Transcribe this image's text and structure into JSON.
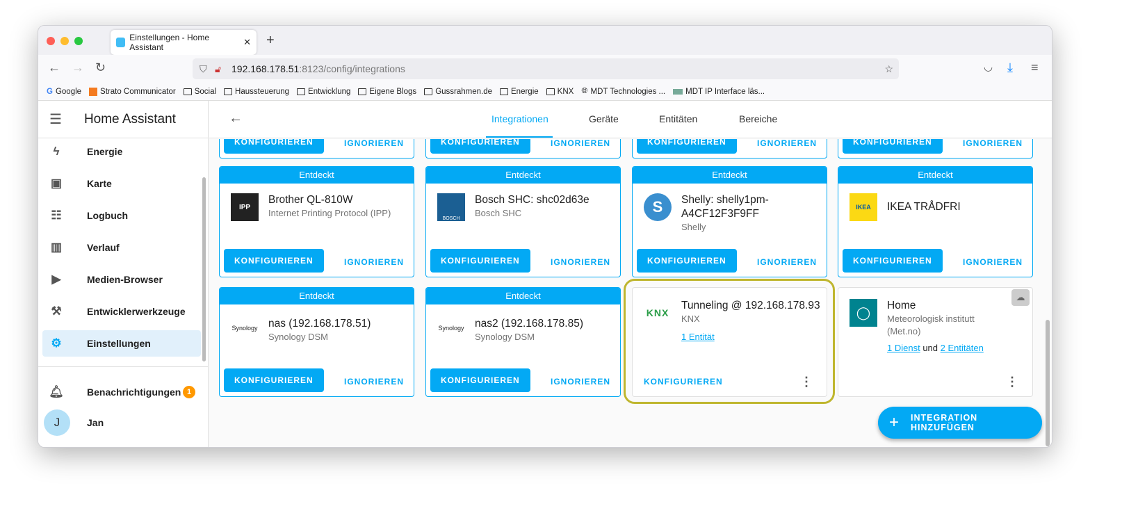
{
  "browser": {
    "tab_title": "Einstellungen - Home Assistant",
    "url_host": "192.168.178.51",
    "url_rest": ":8123/config/integrations",
    "bookmarks": [
      "Google",
      "Strato Communicator",
      "Social",
      "Haussteuerung",
      "Entwicklung",
      "Eigene Blogs",
      "Gussrahmen.de",
      "Energie",
      "KNX",
      "MDT Technologies ...",
      "MDT IP Interface läs..."
    ]
  },
  "sidebar": {
    "title": "Home Assistant",
    "items": [
      {
        "label": "Energie",
        "icon": "lightning-icon"
      },
      {
        "label": "Karte",
        "icon": "map-icon"
      },
      {
        "label": "Logbuch",
        "icon": "list-icon"
      },
      {
        "label": "Verlauf",
        "icon": "chart-icon"
      },
      {
        "label": "Medien-Browser",
        "icon": "play-icon"
      },
      {
        "label": "Entwicklerwerkzeuge",
        "icon": "hammer-icon"
      },
      {
        "label": "Einstellungen",
        "icon": "gear-icon"
      }
    ],
    "notifications": {
      "label": "Benachrichtigungen",
      "count": "1"
    },
    "user": {
      "name": "Jan",
      "initial": "J"
    }
  },
  "header": {
    "tabs": [
      "Integrationen",
      "Geräte",
      "Entitäten",
      "Bereiche"
    ]
  },
  "cards": {
    "discovered": "Entdeckt",
    "configure": "KONFIGURIEREN",
    "ignore": "IGNORIEREN",
    "items": [
      {
        "title": "Brother QL-810W",
        "sub": "Internet Printing Protocol (IPP)",
        "logo": "IPP"
      },
      {
        "title": "Bosch SHC: shc02d63e",
        "sub": "Bosch SHC",
        "logo": "BOSCH"
      },
      {
        "title": "Shelly: shelly1pm-A4CF12F3F9FF",
        "sub": "Shelly",
        "logo": "S"
      },
      {
        "title": "IKEA TRÅDFRI",
        "sub": "",
        "logo": "IKEA"
      },
      {
        "title": "nas (192.168.178.51)",
        "sub": "Synology DSM",
        "logo": "Synology"
      },
      {
        "title": "nas2 (192.168.178.85)",
        "sub": "Synology DSM",
        "logo": "Synology"
      }
    ],
    "knx": {
      "title": "Tunneling @ 192.168.178.93",
      "sub": "KNX",
      "link": "1 Entität",
      "logo": "KNX"
    },
    "home": {
      "title": "Home",
      "sub": "Meteorologisk institutt (Met.no)",
      "link1": "1 Dienst",
      "and": "und",
      "link2": "2 Entitäten"
    }
  },
  "fab": {
    "label": "INTEGRATION HINZUFÜGEN"
  },
  "colors": {
    "accent": "#03a9f4",
    "highlight": "#bfb62f",
    "badge": "#ff9800"
  }
}
